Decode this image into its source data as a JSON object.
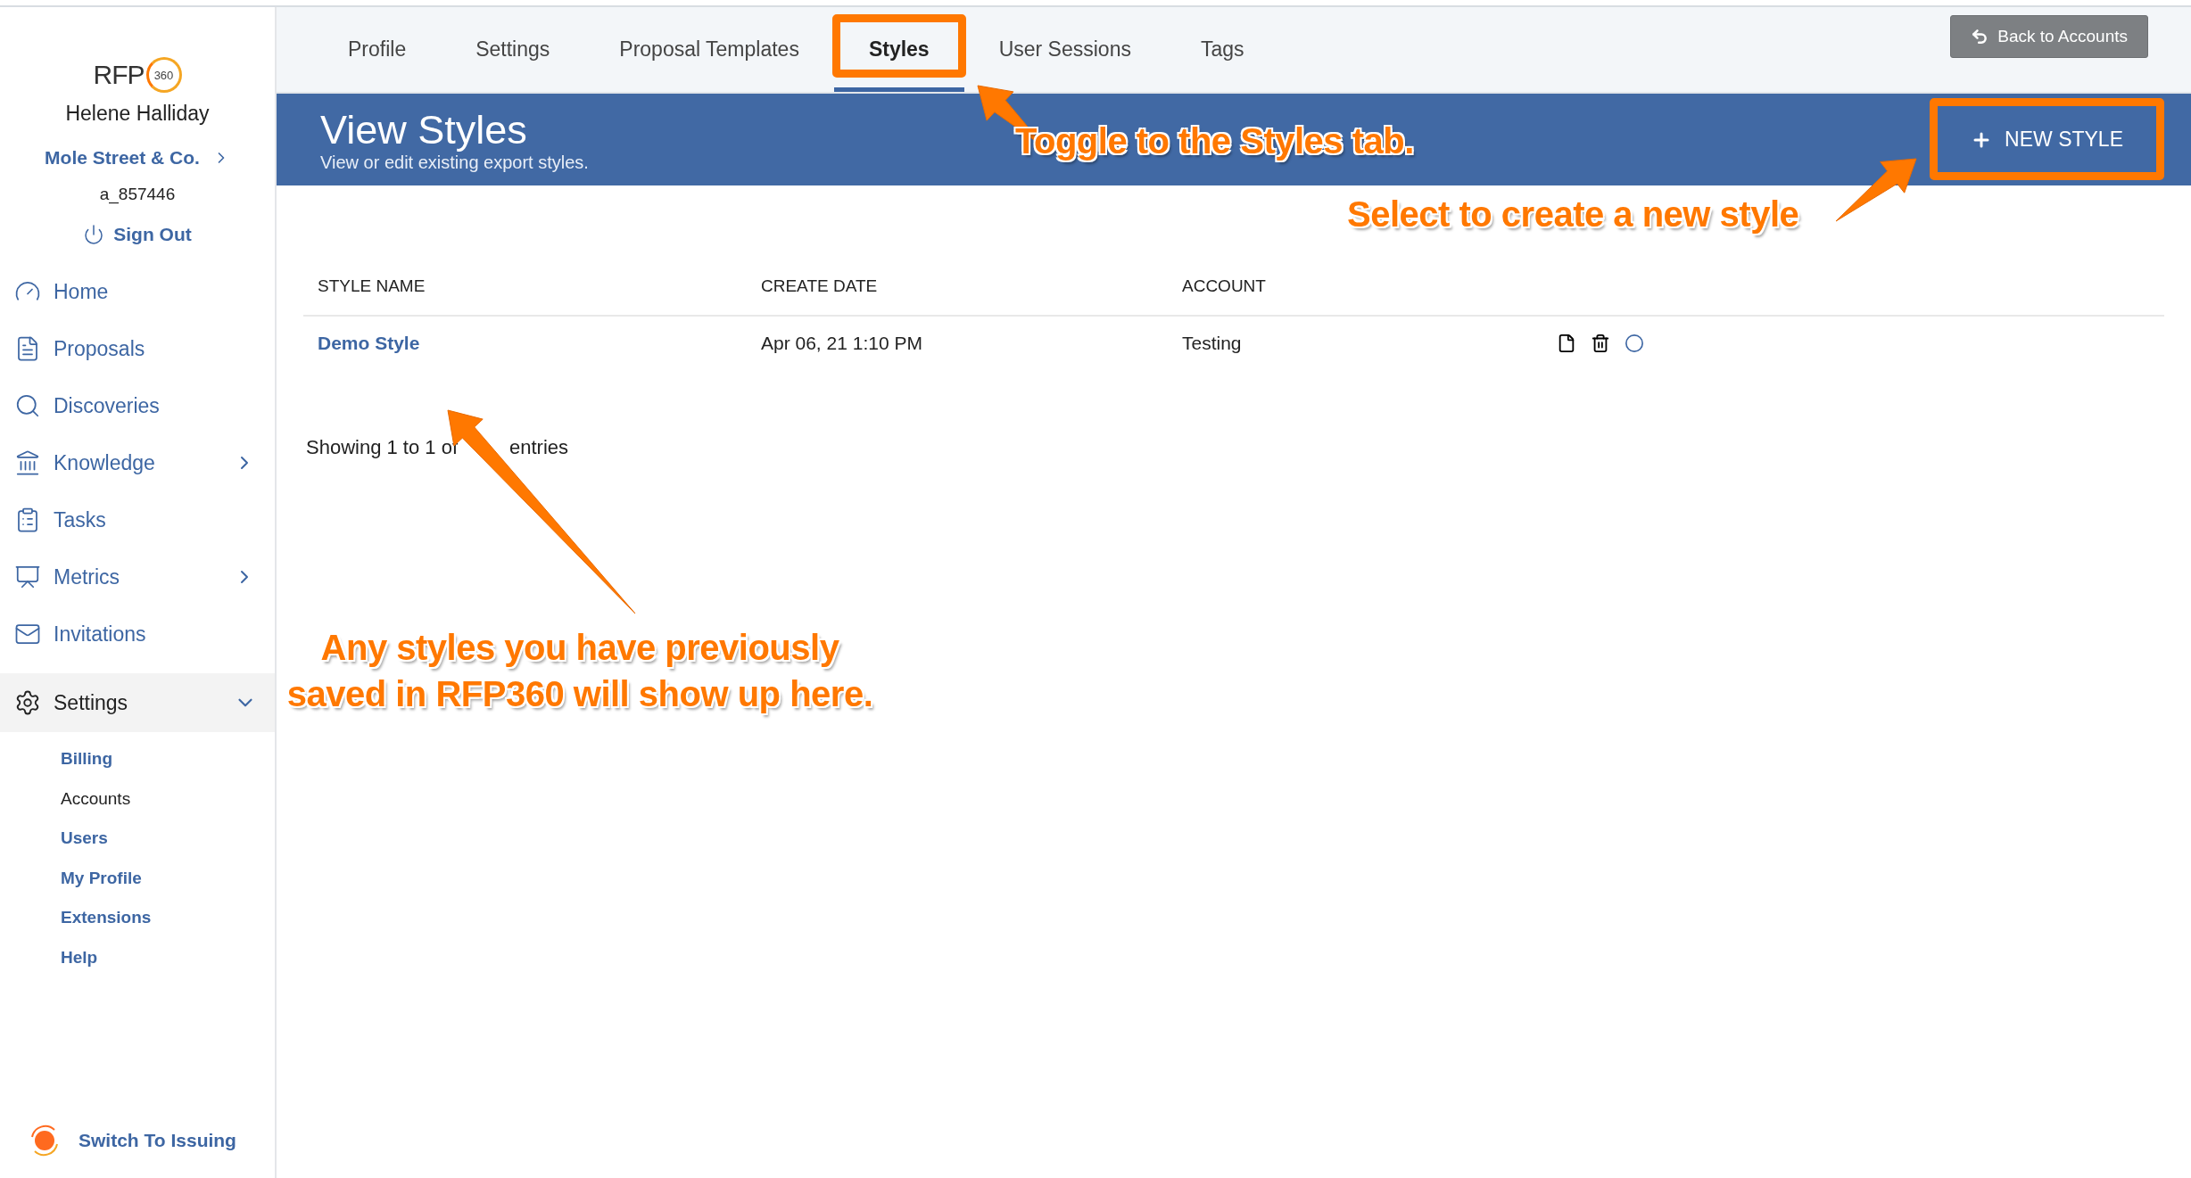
{
  "sidebar": {
    "logo": {
      "text": "RFP",
      "badge": "360"
    },
    "user_name": "Helene Halliday",
    "company": "Mole Street & Co.",
    "account_id": "a_857446",
    "sign_out": "Sign Out",
    "nav": [
      {
        "label": "Home",
        "has_submenu": false
      },
      {
        "label": "Proposals",
        "has_submenu": false
      },
      {
        "label": "Discoveries",
        "has_submenu": false
      },
      {
        "label": "Knowledge",
        "has_submenu": true
      },
      {
        "label": "Tasks",
        "has_submenu": false
      },
      {
        "label": "Metrics",
        "has_submenu": true
      },
      {
        "label": "Invitations",
        "has_submenu": false
      }
    ],
    "settings": {
      "label": "Settings",
      "expanded": true,
      "items": [
        {
          "label": "Billing",
          "selected": false
        },
        {
          "label": "Accounts",
          "selected": true
        },
        {
          "label": "Users",
          "selected": false
        },
        {
          "label": "My Profile",
          "selected": false
        },
        {
          "label": "Extensions",
          "selected": false
        },
        {
          "label": "Help",
          "selected": false
        }
      ]
    },
    "switch": "Switch To Issuing"
  },
  "tabs": [
    {
      "label": "Profile",
      "selected": false,
      "highlighted": false
    },
    {
      "label": "Settings",
      "selected": false,
      "highlighted": false
    },
    {
      "label": "Proposal Templates",
      "selected": false,
      "highlighted": false
    },
    {
      "label": "Styles",
      "selected": true,
      "highlighted": true
    },
    {
      "label": "User Sessions",
      "selected": false,
      "highlighted": false
    },
    {
      "label": "Tags",
      "selected": false,
      "highlighted": false
    }
  ],
  "back_button": "Back to Accounts",
  "header": {
    "title": "View Styles",
    "subtitle": "View or edit existing export styles.",
    "new_button": {
      "label": "NEW STYLE",
      "highlighted": true
    }
  },
  "table": {
    "columns": [
      "STYLE NAME",
      "CREATE DATE",
      "ACCOUNT"
    ],
    "rows": [
      {
        "name": "Demo Style",
        "date": "Apr 06, 21 1:10 PM",
        "account": "Testing"
      }
    ]
  },
  "footer": {
    "before": "Showing 1 to 1 of",
    "after": "entries"
  },
  "annotations": [
    {
      "kind": "tab",
      "text": "Toggle to the Styles tab."
    },
    {
      "kind": "button",
      "text": "Select to create a new style"
    },
    {
      "kind": "list",
      "text": "Any styles you have previously saved in RFP360 will show up here."
    }
  ]
}
